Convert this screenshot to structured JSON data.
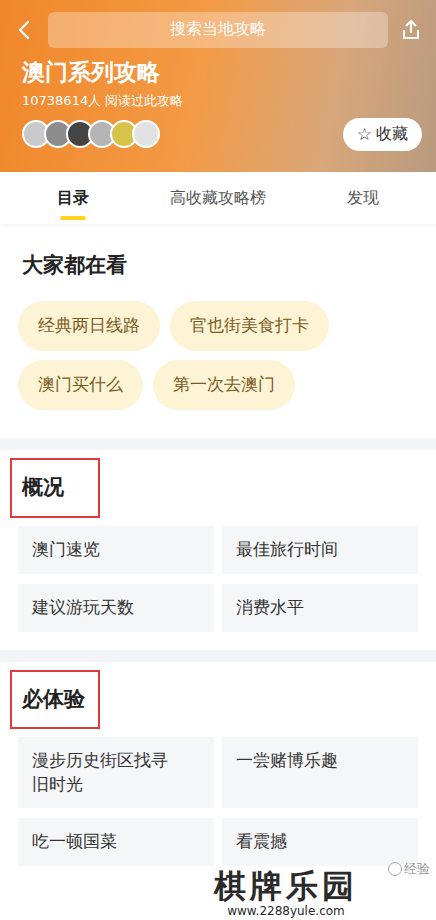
{
  "header": {
    "search_placeholder": "搜索当地攻略",
    "title": "澳门系列攻略",
    "readers": "10738614人",
    "readers_suffix": "阅读过此攻略",
    "favorite": {
      "icon": "☆",
      "label": "收藏"
    }
  },
  "tabs": [
    {
      "label": "目录",
      "selected": true
    },
    {
      "label": "高收藏攻略榜",
      "selected": false
    },
    {
      "label": "发现",
      "selected": false
    }
  ],
  "sections": [
    {
      "title": "大家都在看",
      "kind": "chips",
      "highlighted": false,
      "items": [
        "经典两日线路",
        "官也街美食打卡",
        "澳门买什么",
        "第一次去澳门"
      ]
    },
    {
      "title": "概况",
      "kind": "grid",
      "highlighted": true,
      "items": [
        "澳门速览",
        "最佳旅行时间",
        "建议游玩天数",
        "消费水平"
      ]
    },
    {
      "title": "必体验",
      "kind": "grid",
      "highlighted": true,
      "items": [
        "漫步历史街区找寻旧时光",
        "一尝赌博乐趣",
        "吃一顿国菜",
        "看震撼"
      ]
    }
  ],
  "watermark": {
    "title": "棋牌乐园",
    "url": "www.2288yule.com",
    "badge": "经验"
  }
}
